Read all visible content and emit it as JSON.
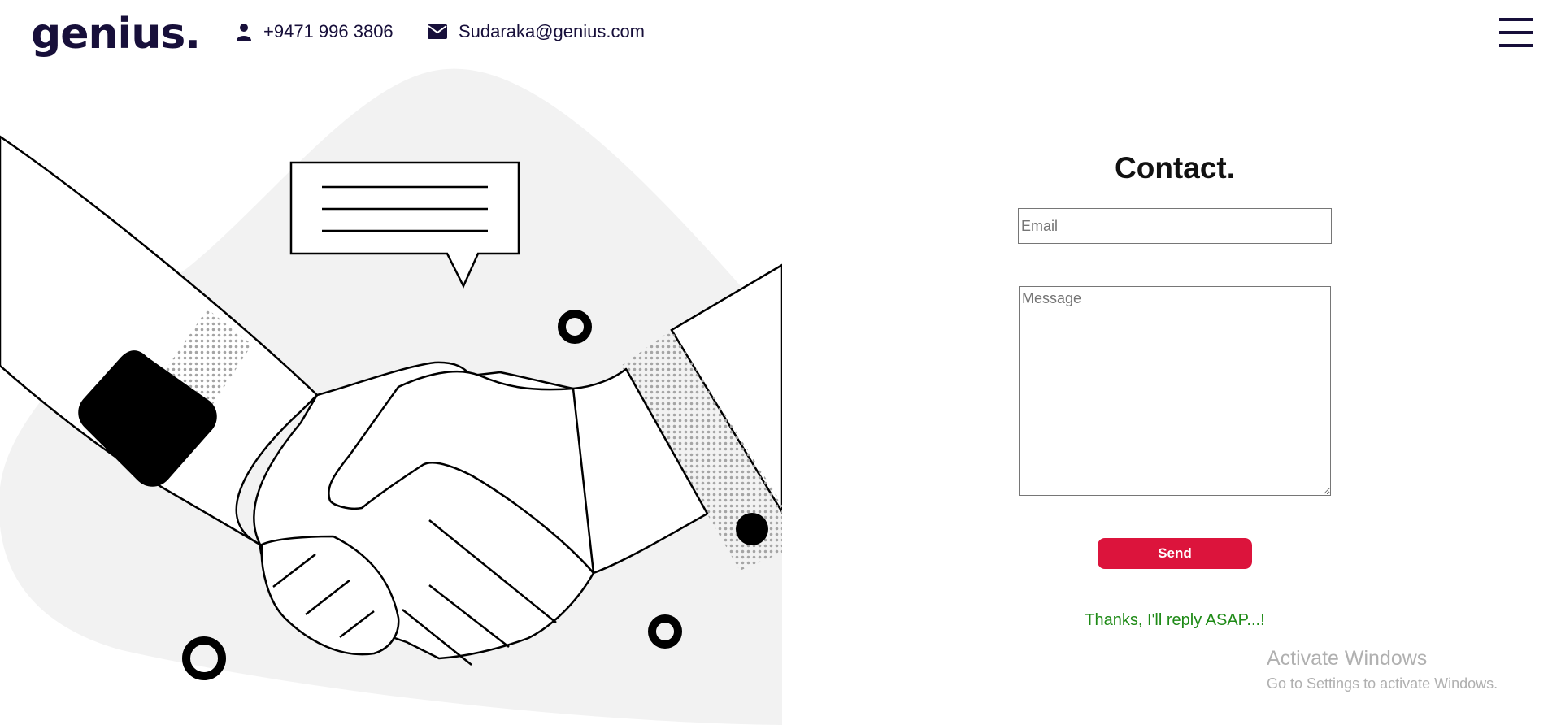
{
  "header": {
    "logo": "genius.",
    "phone": "+9471 996 3806",
    "email": "Sudaraka@genius.com",
    "icons": [
      "user-icon",
      "envelope-icon",
      "hamburger-menu-icon"
    ]
  },
  "contact_form": {
    "title": "Contact.",
    "email_placeholder": "Email",
    "email_value": "",
    "message_placeholder": "Message",
    "message_value": "",
    "send_label": "Send",
    "confirmation": "Thanks, I'll reply ASAP...!"
  },
  "watermark": {
    "title": "Activate Windows",
    "subtitle": "Go to Settings to activate Windows."
  },
  "colors": {
    "brand": "#170f3a",
    "send_button": "#dc143c",
    "confirmation_text": "#1e8a16",
    "blob_background": "#f2f2f2"
  }
}
